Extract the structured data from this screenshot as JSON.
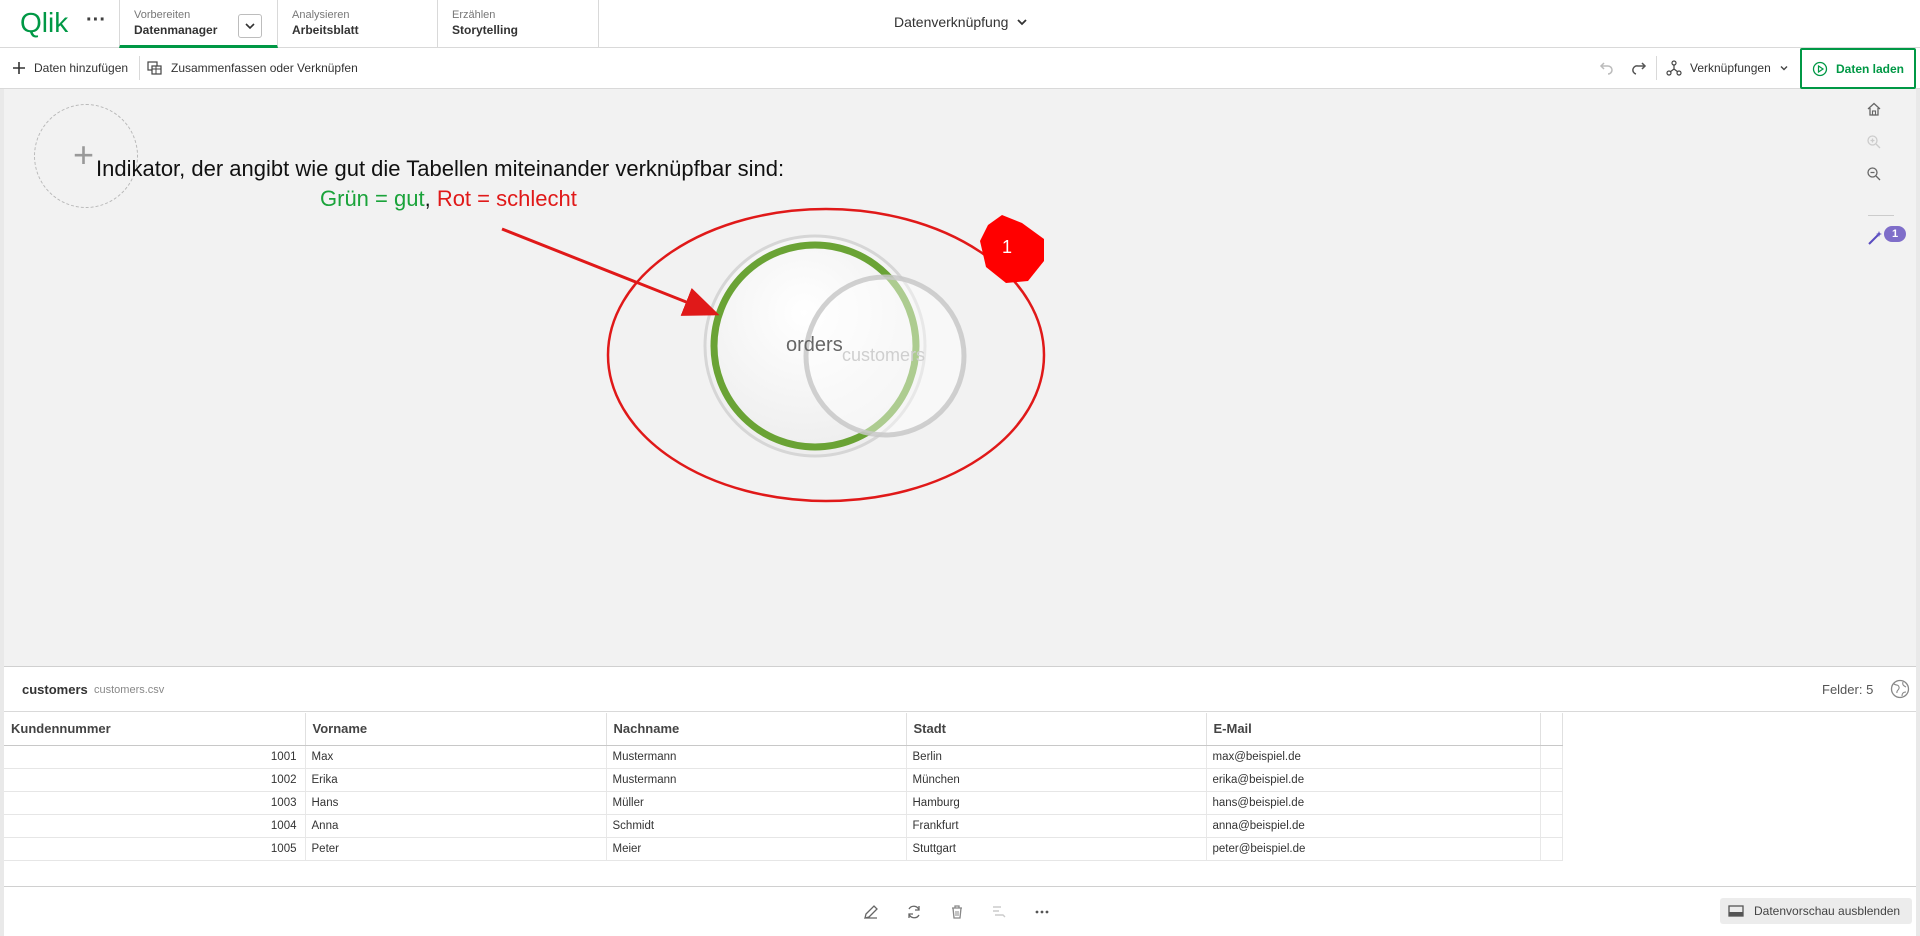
{
  "app": {
    "logo_text": "Qlik",
    "brand_color": "#009845"
  },
  "nav": {
    "tabs": [
      {
        "sub": "Vorbereiten",
        "main": "Datenmanager"
      },
      {
        "sub": "Analysieren",
        "main": "Arbeitsblatt"
      },
      {
        "sub": "Erzählen",
        "main": "Storytelling"
      }
    ],
    "center_title": "Datenverknüpfung"
  },
  "toolbar": {
    "add_data_label": "Daten hinzufügen",
    "merge_label": "Zusammenfassen oder Verknüpfen",
    "associations_label": "Verknüpfungen",
    "load_data_label": "Daten laden"
  },
  "canvas": {
    "annotation_line1": "Indikator, der angibt wie gut die Tabellen miteinander verknüpfbar sind:",
    "annotation_good": "Grün = gut",
    "annotation_comma": ", ",
    "annotation_bad": "Rot = schlecht",
    "table_orders": "orders",
    "table_customers": "customers",
    "marker_number": "1",
    "recommendation_count": "1",
    "good_color": "#1aa33a",
    "bad_color": "#e01919"
  },
  "preview": {
    "table_name": "customers",
    "file_name": "customers.csv",
    "fields_label": "Felder: 5",
    "columns": [
      "Kundennummer",
      "Vorname",
      "Nachname",
      "Stadt",
      "E-Mail"
    ],
    "rows": [
      [
        "1001",
        "Max",
        "Mustermann",
        "Berlin",
        "max@beispiel.de"
      ],
      [
        "1002",
        "Erika",
        "Mustermann",
        "München",
        "erika@beispiel.de"
      ],
      [
        "1003",
        "Hans",
        "Müller",
        "Hamburg",
        "hans@beispiel.de"
      ],
      [
        "1004",
        "Anna",
        "Schmidt",
        "Frankfurt",
        "anna@beispiel.de"
      ],
      [
        "1005",
        "Peter",
        "Meier",
        "Stuttgart",
        "peter@beispiel.de"
      ]
    ]
  },
  "bottom": {
    "hide_preview_label": "Datenvorschau ausblenden"
  }
}
